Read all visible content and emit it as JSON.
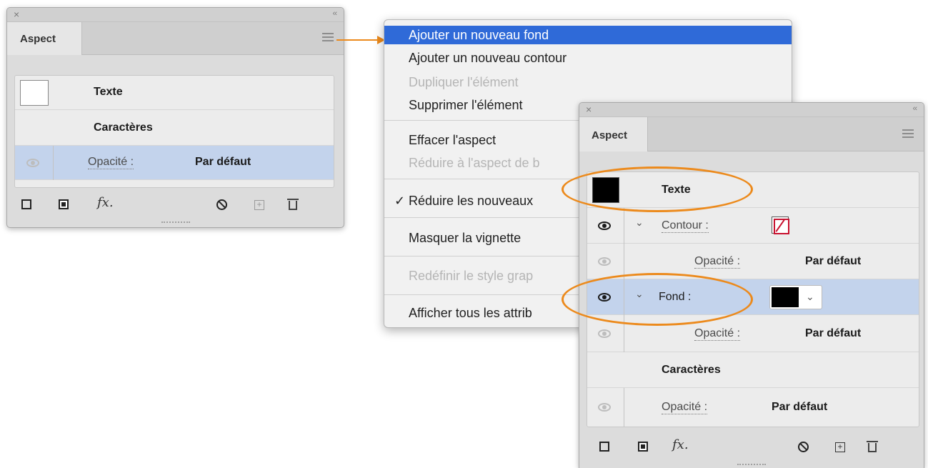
{
  "panel_small": {
    "close": "×",
    "collapse": "‹‹",
    "tab": "Aspect",
    "rows": {
      "texte": "Texte",
      "caracteres": "Caractères",
      "opacite_label": "Opacité :",
      "opacite_value": "Par défaut"
    },
    "toolbar": {
      "fx": "fx."
    }
  },
  "context_menu": {
    "items": [
      {
        "label": "Ajouter un nouveau fond",
        "state": "highlighted"
      },
      {
        "label": "Ajouter un nouveau contour",
        "state": "enabled"
      },
      {
        "label": "Dupliquer l'élément",
        "state": "disabled"
      },
      {
        "label": "Supprimer l'élément",
        "state": "enabled"
      },
      {
        "label": "Effacer l'aspect",
        "state": "enabled"
      },
      {
        "label": "Réduire à l'aspect de b",
        "state": "disabled"
      },
      {
        "label": "Réduire les nouveaux",
        "state": "checked"
      },
      {
        "label": "Masquer la vignette",
        "state": "enabled"
      },
      {
        "label": "Redéfinir le style grap",
        "state": "disabled"
      },
      {
        "label": "Afficher tous les attrib",
        "state": "enabled"
      }
    ],
    "checkmark": "✓"
  },
  "panel_large": {
    "close": "×",
    "collapse": "‹‹",
    "tab": "Aspect",
    "rows": {
      "texte": "Texte",
      "contour_label": "Contour :",
      "opacite1_label": "Opacité :",
      "opacite1_value": "Par défaut",
      "fond_label": "Fond :",
      "opacite2_label": "Opacité :",
      "opacite2_value": "Par défaut",
      "caracteres": "Caractères",
      "opacite3_label": "Opacité :",
      "opacite3_value": "Par défaut"
    },
    "toolbar": {
      "fx": "fx."
    }
  },
  "colors": {
    "highlight": "#2f6ad8",
    "selected_row": "#c3d3ec",
    "annotation": "#ec8a1c",
    "stroke_swatch": "#c8102e"
  }
}
